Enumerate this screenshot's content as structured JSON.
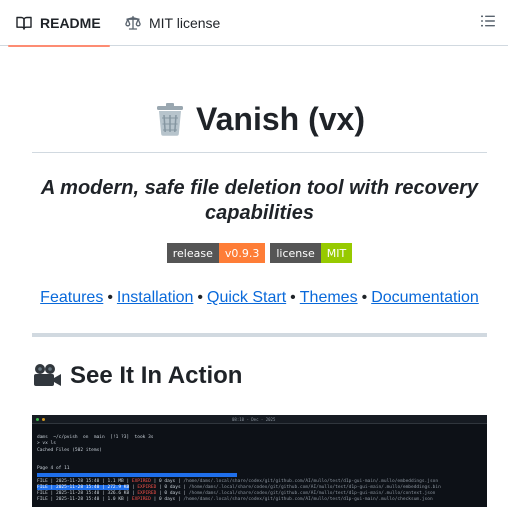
{
  "tabs": {
    "readme": {
      "label": "README",
      "icon": "book-icon"
    },
    "license": {
      "label": "MIT license",
      "icon": "scale-icon"
    },
    "outline_icon": "list-unordered-icon"
  },
  "readme": {
    "title_emoji": "trash-can-emoji",
    "title": "Vanish (vx)",
    "tagline": "A modern, safe file deletion tool with recovery capabilities",
    "badges": [
      {
        "label": "release",
        "value": "v0.9.3",
        "color": "#fe7d37"
      },
      {
        "label": "license",
        "value": "MIT",
        "color": "#97ca00"
      }
    ],
    "nav_links": [
      "Features",
      "Installation",
      "Quick Start",
      "Themes",
      "Documentation"
    ],
    "nav_separator": "•",
    "section_emoji": "movie-camera-emoji",
    "section_title": "See It In Action"
  },
  "terminal": {
    "clock": "08:10 - Dec - 2025",
    "prompt": "dams  ~/c/pvish  on  main  [!1 ?3]  took 3s",
    "command": "> vx ls",
    "cached_header": "Cached Files (502 items)",
    "page": "Page 4 of 11",
    "rows": [
      {
        "kind": "FILE",
        "date": "2025-11-28 15:40",
        "size": "1.1 MB",
        "status": "EXPIRED",
        "days": "0 days",
        "path": "/home/dams/.local/share/codex/git/github.com/AI/mullo/test/d1p-gui-main/.mullo/embeddings.json"
      },
      {
        "kind": "FILE",
        "date": "2025-11-28 15:40",
        "size": "272.9 KB",
        "status": "EXPIRED",
        "days": "0 days",
        "path": "/home/dams/.local/share/codex/git/github.com/AI/mullo/test/d1p-gui-main/.mullo/embeddings.bin"
      },
      {
        "kind": "FILE",
        "date": "2025-11-28 15:40",
        "size": "326.6 KB",
        "status": "EXPIRED",
        "days": "0 days",
        "path": "/home/dams/.local/share/codex/git/github.com/AI/mullo/test/d1p-gui-main/.mullo/context.json"
      },
      {
        "kind": "FILE",
        "date": "2025-11-28 15:40",
        "size": "1.0 KB",
        "status": "EXPIRED",
        "days": "0 days",
        "path": "/home/dams/.local/share/codex/git/github.com/AI/mullo/test/d1p-gui-main/.mullo/checksum.json"
      }
    ]
  }
}
